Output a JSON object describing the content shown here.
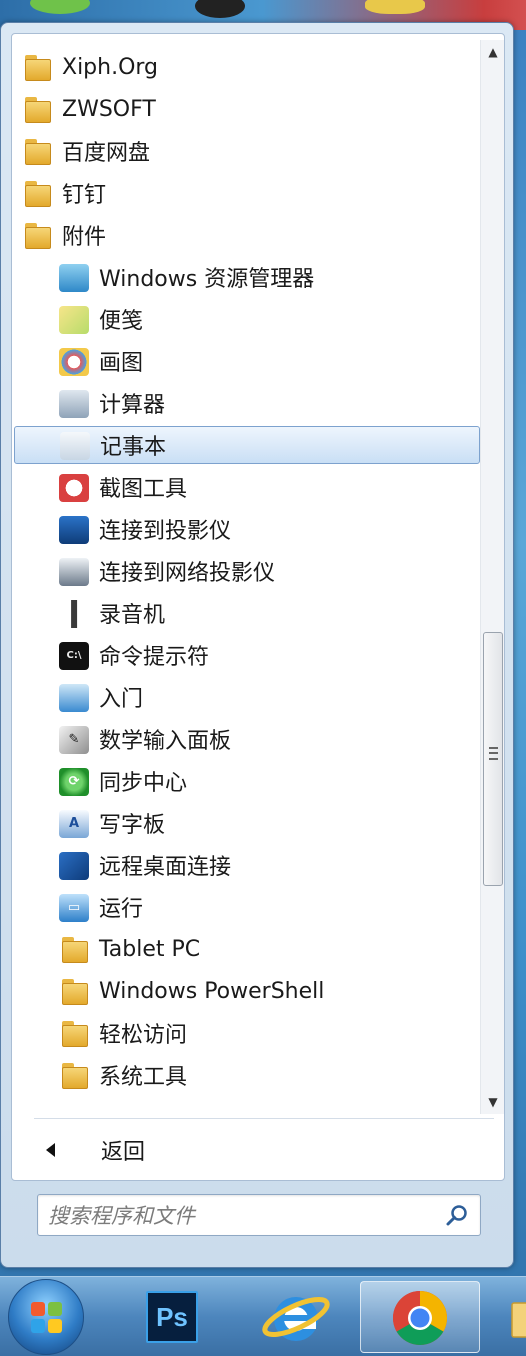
{
  "start_menu": {
    "items": [
      {
        "label": "Xiph.Org",
        "type": "folder",
        "level": 1,
        "icon": "folder-icon"
      },
      {
        "label": "ZWSOFT",
        "type": "folder",
        "level": 1,
        "icon": "folder-icon"
      },
      {
        "label": "百度网盘",
        "type": "folder",
        "level": 1,
        "icon": "folder-icon"
      },
      {
        "label": "钉钉",
        "type": "folder",
        "level": 1,
        "icon": "folder-icon"
      },
      {
        "label": "附件",
        "type": "folder",
        "level": 1,
        "icon": "folder-icon"
      },
      {
        "label": "Windows 资源管理器",
        "type": "app",
        "level": 2,
        "icon": "explorer-icon"
      },
      {
        "label": "便笺",
        "type": "app",
        "level": 2,
        "icon": "sticky-notes-icon"
      },
      {
        "label": "画图",
        "type": "app",
        "level": 2,
        "icon": "paint-icon"
      },
      {
        "label": "计算器",
        "type": "app",
        "level": 2,
        "icon": "calculator-icon"
      },
      {
        "label": "记事本",
        "type": "app",
        "level": 2,
        "icon": "notepad-icon",
        "selected": true
      },
      {
        "label": "截图工具",
        "type": "app",
        "level": 2,
        "icon": "snipping-tool-icon"
      },
      {
        "label": "连接到投影仪",
        "type": "app",
        "level": 2,
        "icon": "projector-icon"
      },
      {
        "label": "连接到网络投影仪",
        "type": "app",
        "level": 2,
        "icon": "network-projector-icon"
      },
      {
        "label": "录音机",
        "type": "app",
        "level": 2,
        "icon": "microphone-icon"
      },
      {
        "label": "命令提示符",
        "type": "app",
        "level": 2,
        "icon": "command-prompt-icon"
      },
      {
        "label": "入门",
        "type": "app",
        "level": 2,
        "icon": "getting-started-icon"
      },
      {
        "label": "数学输入面板",
        "type": "app",
        "level": 2,
        "icon": "math-input-icon"
      },
      {
        "label": "同步中心",
        "type": "app",
        "level": 2,
        "icon": "sync-center-icon"
      },
      {
        "label": "写字板",
        "type": "app",
        "level": 2,
        "icon": "wordpad-icon"
      },
      {
        "label": "远程桌面连接",
        "type": "app",
        "level": 2,
        "icon": "remote-desktop-icon"
      },
      {
        "label": "运行",
        "type": "app",
        "level": 2,
        "icon": "run-icon"
      },
      {
        "label": "Tablet PC",
        "type": "folder",
        "level": 2,
        "icon": "folder-icon"
      },
      {
        "label": "Windows PowerShell",
        "type": "folder",
        "level": 2,
        "icon": "folder-icon"
      },
      {
        "label": "轻松访问",
        "type": "folder",
        "level": 2,
        "icon": "folder-icon"
      },
      {
        "label": "系统工具",
        "type": "folder",
        "level": 2,
        "icon": "folder-icon"
      }
    ],
    "back_label": "返回",
    "search": {
      "placeholder": "搜索程序和文件"
    }
  },
  "taskbar": {
    "photoshop_label": "Ps",
    "apps": [
      "start-orb",
      "photoshop",
      "internet-explorer",
      "chrome",
      "explorer"
    ]
  },
  "colors": {
    "selection": "#c9dff5",
    "taskbar": "#4d86bd",
    "menu_bg": "#dbe8f4"
  }
}
